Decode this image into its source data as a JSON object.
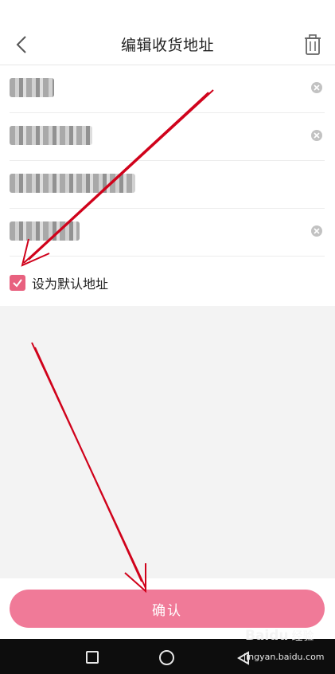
{
  "header": {
    "title": "编辑收货地址",
    "back_icon": "chevron-left-icon",
    "delete_icon": "trash-icon"
  },
  "form": {
    "fields": [
      {
        "name": "recipient-name-field",
        "value_state": "obscured"
      },
      {
        "name": "phone-field",
        "value_state": "obscured"
      },
      {
        "name": "region-field",
        "value_state": "obscured"
      },
      {
        "name": "detail-address-field",
        "value_state": "obscured"
      }
    ],
    "default_address": {
      "label": "设为默认地址",
      "checked": true
    }
  },
  "actions": {
    "confirm_label": "确认"
  },
  "watermark": {
    "brand": "Bai",
    "brand_mark": "du",
    "brand_suffix": "经验",
    "url": "jingyan.baidu.com"
  },
  "colors": {
    "accent": "#e8617f",
    "confirm_button": "#f07a98",
    "annotation_arrow": "#d0021b",
    "background_gray": "#f3f3f3",
    "navbar": "#0d0d0d"
  }
}
